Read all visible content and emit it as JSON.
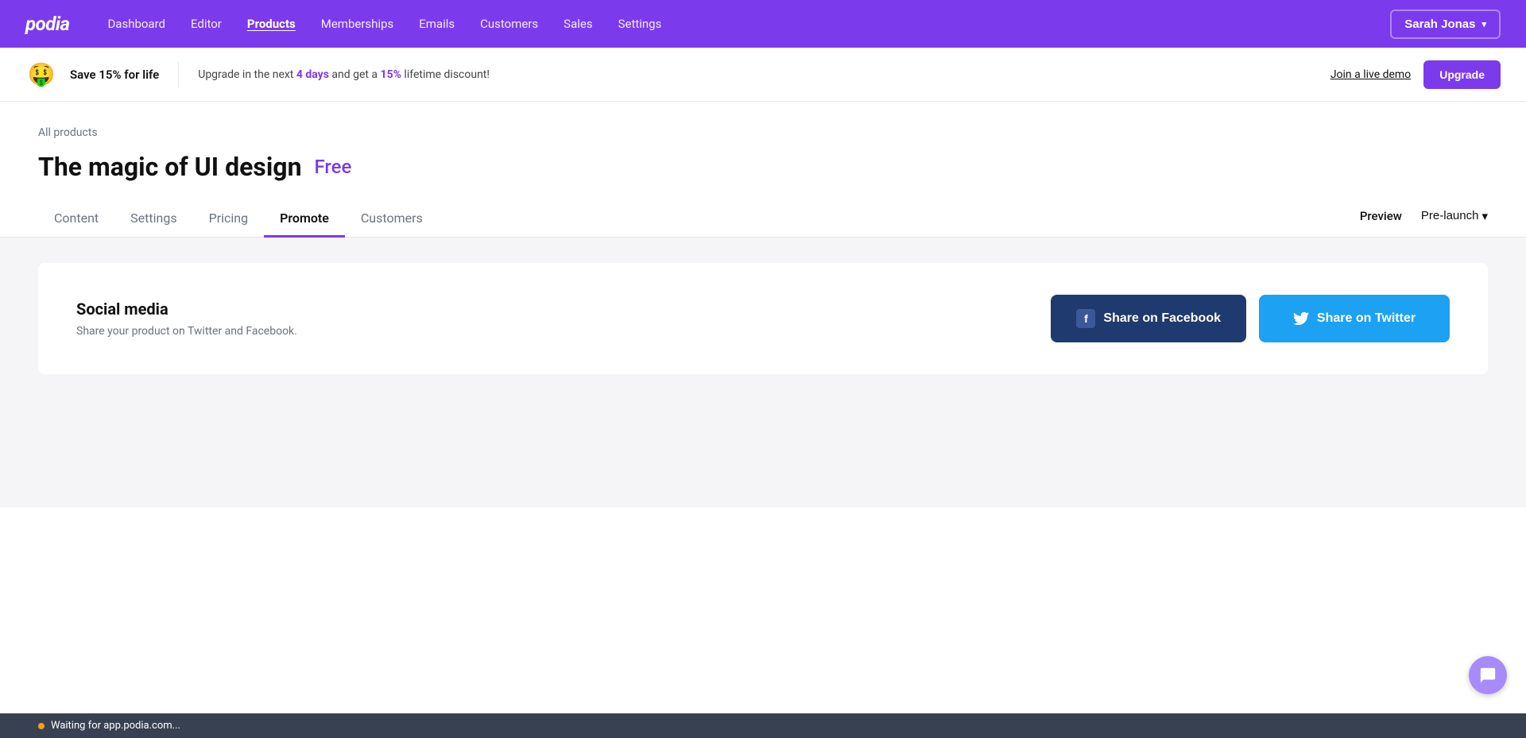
{
  "topnav": {
    "logo": "podia",
    "links": [
      {
        "label": "Dashboard",
        "active": false
      },
      {
        "label": "Editor",
        "active": false
      },
      {
        "label": "Products",
        "active": true
      },
      {
        "label": "Memberships",
        "active": false
      },
      {
        "label": "Emails",
        "active": false
      },
      {
        "label": "Customers",
        "active": false
      },
      {
        "label": "Sales",
        "active": false
      },
      {
        "label": "Settings",
        "active": false
      }
    ],
    "user_name": "Sarah Jonas",
    "chevron": "▾"
  },
  "banner": {
    "icon": "🤑",
    "main_text": "Save 15% for life",
    "sub_text_prefix": "Upgrade in the next ",
    "days": "4 days",
    "sub_text_mid": " and get a ",
    "pct": "15%",
    "sub_text_suffix": " lifetime discount!",
    "demo_link": "Join a live demo",
    "upgrade_btn": "Upgrade"
  },
  "breadcrumb": {
    "label": "All products"
  },
  "page": {
    "title": "The magic of UI design",
    "badge": "Free"
  },
  "tabs": {
    "items": [
      {
        "label": "Content",
        "active": false
      },
      {
        "label": "Settings",
        "active": false
      },
      {
        "label": "Pricing",
        "active": false
      },
      {
        "label": "Promote",
        "active": true
      },
      {
        "label": "Customers",
        "active": false
      }
    ],
    "preview_label": "Preview",
    "prelaunch_label": "Pre-launch",
    "prelaunch_chevron": "▾"
  },
  "promote": {
    "social_card": {
      "title": "Social media",
      "subtitle": "Share your product on Twitter and Facebook.",
      "fb_btn": "Share on Facebook",
      "tw_btn": "Share on Twitter",
      "fb_icon": "f",
      "tw_icon": "t"
    }
  },
  "bottom_bar": {
    "text": "Waiting for app.podia.com..."
  },
  "chat": {
    "icon": "chat-icon"
  }
}
